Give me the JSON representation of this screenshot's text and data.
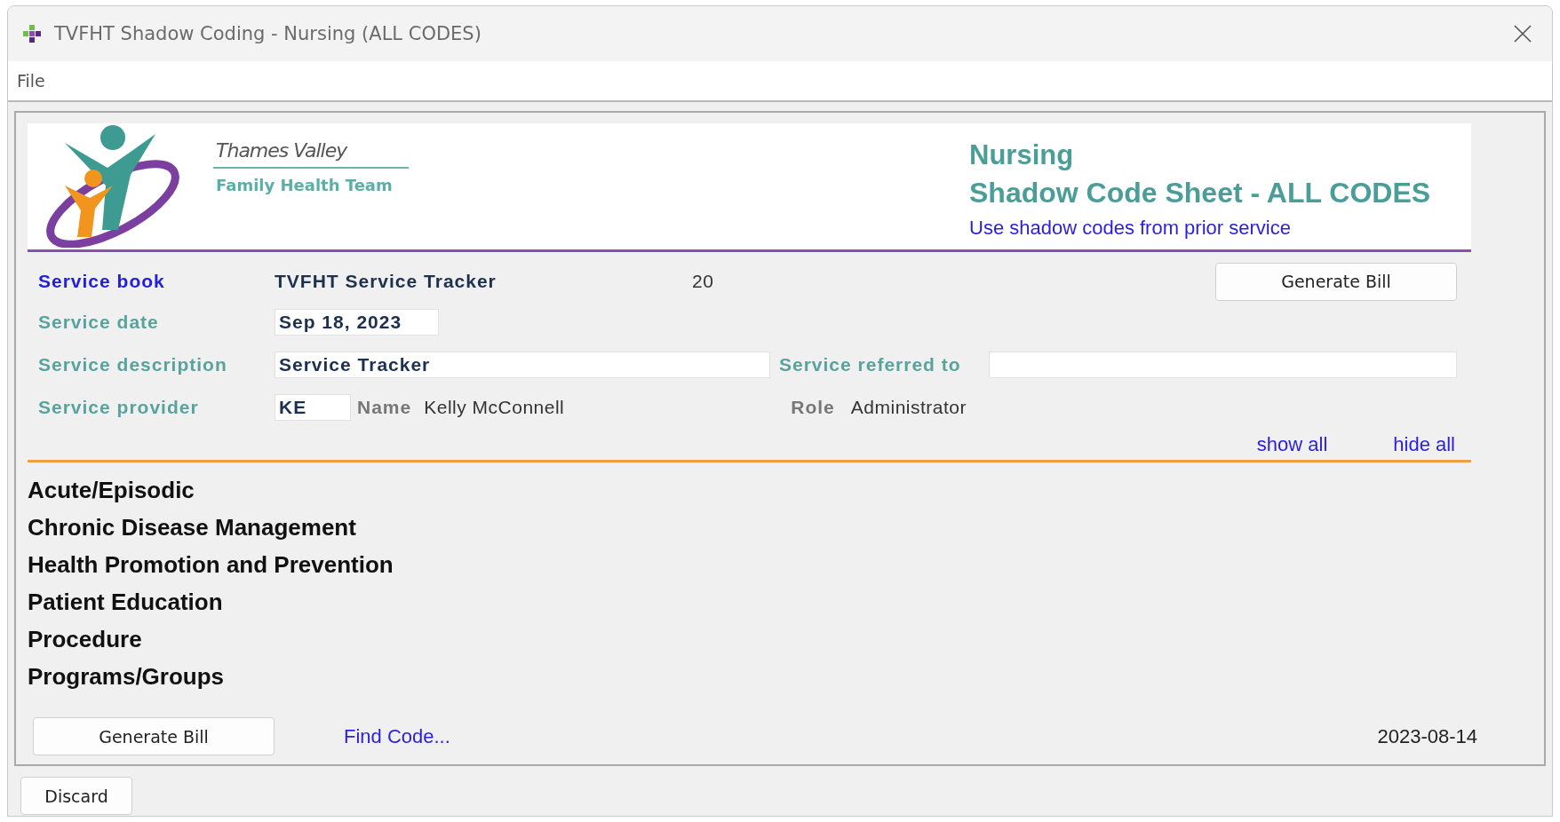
{
  "window": {
    "title": "TVFHT Shadow Coding - Nursing (ALL CODES)"
  },
  "menu": [
    "File"
  ],
  "header": {
    "org_line1": "Thames Valley",
    "org_line2": "Family Health Team",
    "title": "Nursing",
    "subtitle": "Shadow Code Sheet - ALL CODES",
    "link": "Use shadow codes from prior service"
  },
  "form": {
    "service_book": {
      "label": "Service book",
      "value": "TVFHT Service Tracker",
      "count": "20"
    },
    "top_button": "Generate Bill",
    "service_date": {
      "label": "Service date",
      "value": "Sep 18, 2023"
    },
    "service_description": {
      "label": "Service description",
      "value": "Service Tracker"
    },
    "service_referred_to": {
      "label": "Service referred to"
    },
    "service_provider": {
      "label": "Service provider",
      "value": "KE",
      "name_label": "Name",
      "name": "Kelly McConnell",
      "role_label": "Role",
      "role": "Administrator"
    }
  },
  "toggles": [
    "show all",
    "hide all"
  ],
  "categories": [
    "Acute/Episodic",
    "Chronic Disease Management",
    "Health Promotion and Prevention",
    "Patient Education",
    "Procedure",
    "Programs/Groups"
  ],
  "footer": {
    "button": "Generate Bill",
    "link": "Find Code...",
    "date": "2023-08-14"
  },
  "discard": "Discard"
}
